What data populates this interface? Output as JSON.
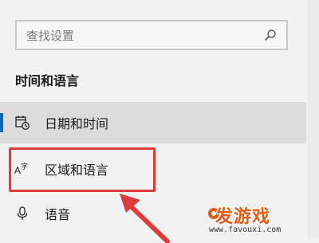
{
  "search": {
    "placeholder": "查找设置"
  },
  "section_title": "时间和语言",
  "nav": {
    "items": [
      {
        "label": "日期和时间",
        "icon": "calendar-clock-icon",
        "selected": true
      },
      {
        "label": "区域和语言",
        "icon": "language-icon",
        "selected": false
      },
      {
        "label": "语音",
        "icon": "microphone-icon",
        "selected": false
      }
    ]
  },
  "watermark": {
    "title": "发游戏",
    "url": "www.favouxi.com"
  },
  "colors": {
    "accent": "#0067c0",
    "highlight": "#e03b3b",
    "watermark": "#e85a14"
  }
}
